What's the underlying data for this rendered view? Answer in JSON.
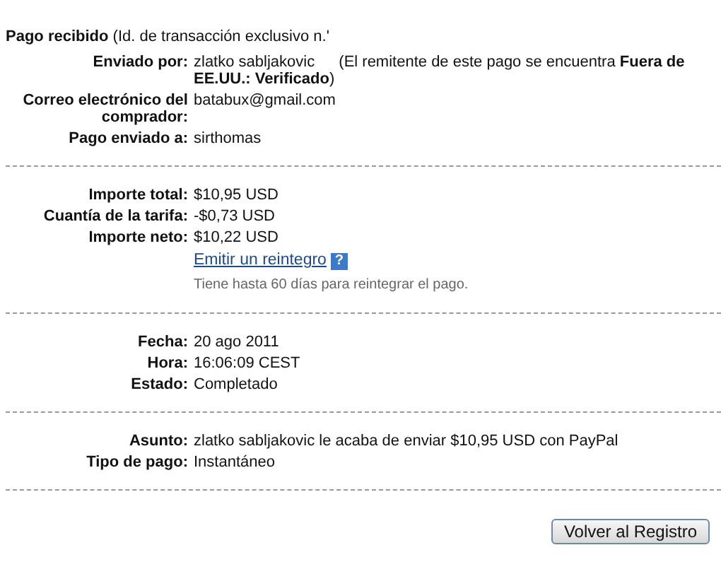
{
  "heading": "**Pago recibido** (Id. de transacción exclusivo n.'",
  "sections": [
    {
      "rows": [
        {
          "label": "Enviado por:",
          "value": "zlatko sabljakovic",
          "note": "(El remitente de este pago se encuentra **Fuera de EE.UU.: Verificado**)"
        },
        {
          "label": "Correo electrónico del comprador:",
          "value": "batabux@gmail.com"
        },
        {
          "label": "Pago enviado a:",
          "value": "sirthomas"
        }
      ]
    },
    {
      "rows": [
        {
          "label": "Importe total:",
          "value": "$10,95 USD"
        },
        {
          "label": "Cuantía de la tarifa:",
          "value": "-$0,73 USD"
        },
        {
          "label": "Importe neto:",
          "value": "$10,22 USD"
        }
      ],
      "link": "Emitir un reintegro",
      "help_icon": "?",
      "hint": "Tiene hasta 60 días para reintegrar el pago."
    },
    {
      "rows": [
        {
          "label": "Fecha:",
          "value": "20 ago 2011"
        },
        {
          "label": "Hora:",
          "value": "16:06:09 CEST"
        },
        {
          "label": "Estado:",
          "value": "Completado"
        }
      ]
    },
    {
      "rows": [
        {
          "label": "Asunto:",
          "value": "zlatko sabljakovic le acaba de enviar $10,95 USD con PayPal"
        },
        {
          "label": "Tipo de pago:",
          "value": "Instantáneo"
        }
      ]
    }
  ],
  "button": "Volver al Registro"
}
